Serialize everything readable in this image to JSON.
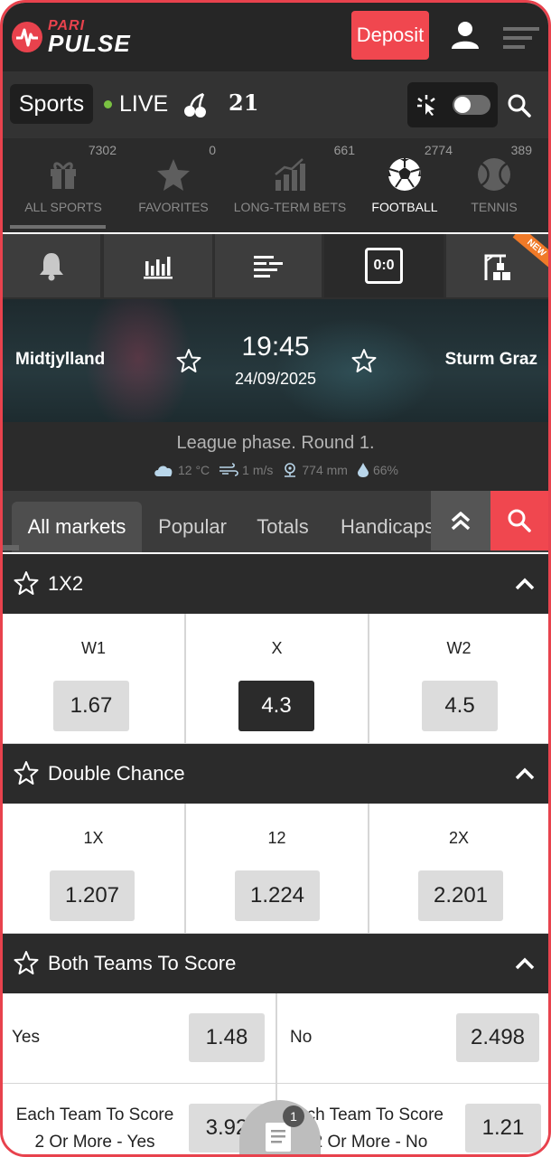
{
  "header": {
    "logo_top": "PARI",
    "logo_bottom": "PULSE",
    "deposit_label": "Deposit"
  },
  "sportsbar": {
    "sports_label": "Sports",
    "live_label": "LIVE",
    "twentyone_label": "21"
  },
  "categories": [
    {
      "label": "ALL SPORTS",
      "count": "7302",
      "icon": "gift-icon"
    },
    {
      "label": "FAVORITES",
      "count": "0",
      "icon": "star-icon"
    },
    {
      "label": "LONG-TERM BETS",
      "count": "661",
      "icon": "growth-chart-icon"
    },
    {
      "label": "FOOTBALL",
      "count": "2774",
      "icon": "football-icon"
    },
    {
      "label": "TENNIS",
      "count": "389",
      "icon": "tennis-ball-icon"
    }
  ],
  "tools": {
    "score_label": "0:0",
    "new_badge": "NEW"
  },
  "match": {
    "team1": "Midtjylland",
    "team2": "Sturm Graz",
    "time": "19:45",
    "date": "24/09/2025",
    "league": "League phase. Round 1.",
    "weather": {
      "temp": "12 °C",
      "wind": "1 m/s",
      "pressure": "774 mm",
      "humidity": "66%"
    }
  },
  "market_tabs": [
    "All markets",
    "Popular",
    "Totals",
    "Handicaps"
  ],
  "markets": {
    "onextwo": {
      "title": "1X2",
      "options": [
        {
          "label": "W1",
          "odds": "1.67"
        },
        {
          "label": "X",
          "odds": "4.3"
        },
        {
          "label": "W2",
          "odds": "4.5"
        }
      ]
    },
    "double_chance": {
      "title": "Double Chance",
      "options": [
        {
          "label": "1X",
          "odds": "1.207"
        },
        {
          "label": "12",
          "odds": "1.224"
        },
        {
          "label": "2X",
          "odds": "2.201"
        }
      ]
    },
    "btts": {
      "title": "Both Teams To Score",
      "yes_label": "Yes",
      "yes_odds": "1.48",
      "no_label": "No",
      "no_odds": "2.498",
      "each_yes_line1": "Each Team To Score",
      "each_yes_line2": "2 Or More - Yes",
      "each_yes_odds": "3.92",
      "each_no_line1": "ach Team To Score",
      "each_no_line2": "2 Or More - No",
      "each_no_odds": "1.21"
    }
  },
  "betslip": {
    "count": "1"
  },
  "colors": {
    "accent": "#f0474f",
    "frame": "#e8424d",
    "live_dot": "#7ac142",
    "dark_bg": "#2b2b2b",
    "new_badge": "#f07a28"
  }
}
